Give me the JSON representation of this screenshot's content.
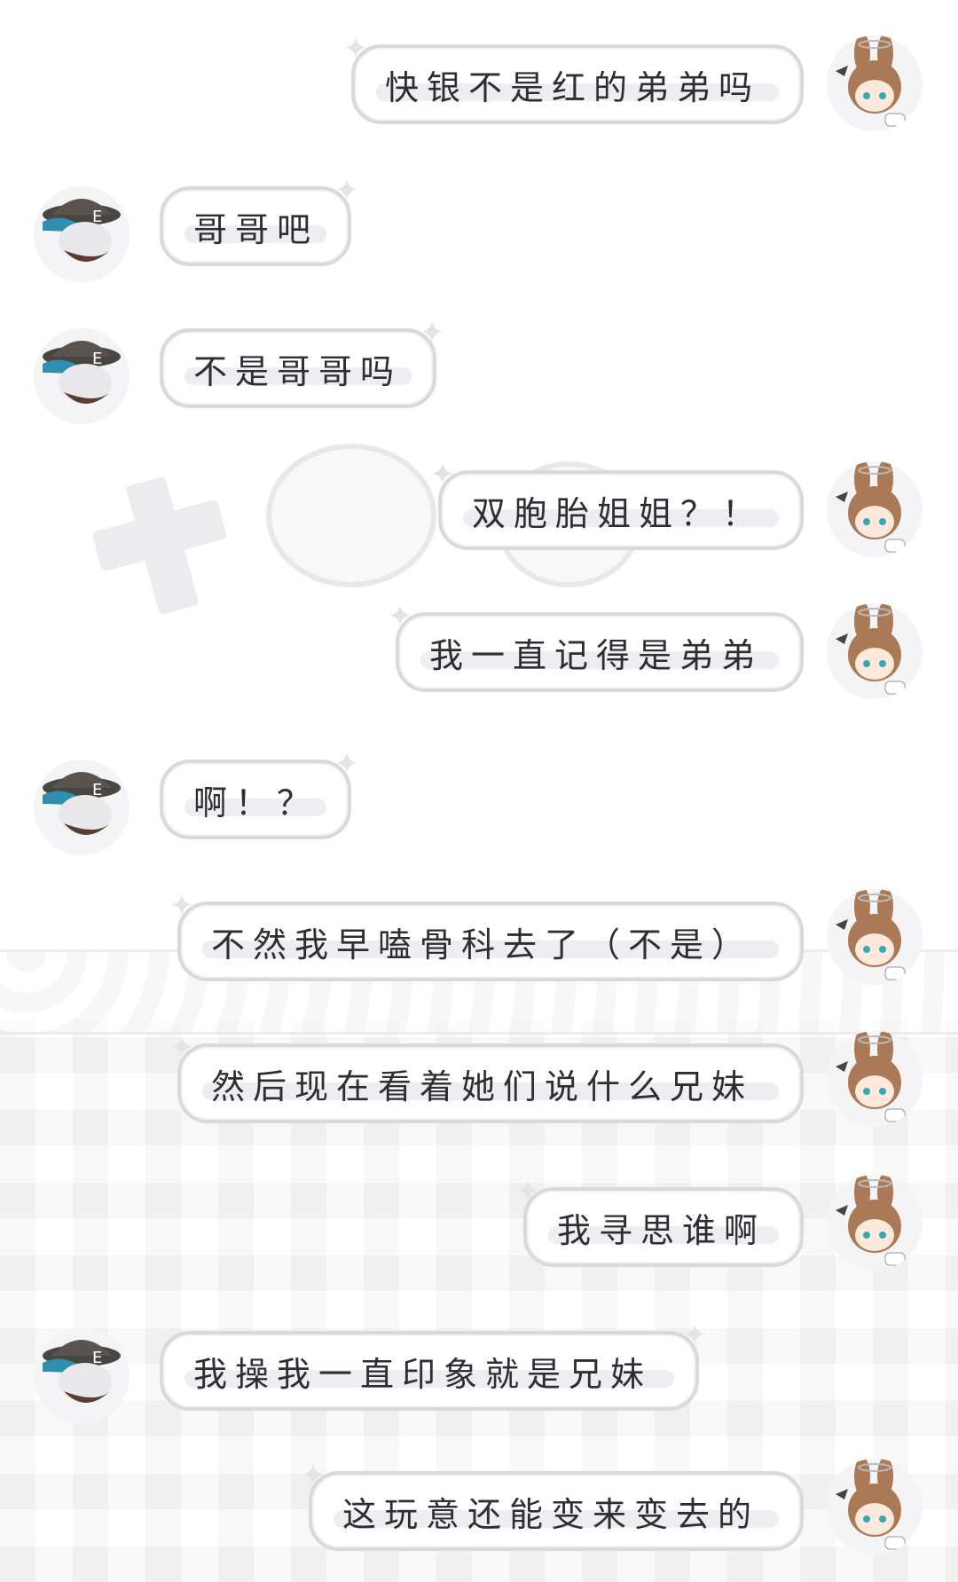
{
  "conversation": {
    "messages": [
      {
        "side": "right",
        "text": "快银不是红的弟弟吗",
        "avatar": "bunny-girl-avatar-icon"
      },
      {
        "side": "left",
        "text": "哥哥吧",
        "avatar": "hat-boy-avatar-icon"
      },
      {
        "side": "left",
        "text": "不是哥哥吗",
        "avatar": "hat-boy-avatar-icon"
      },
      {
        "side": "right",
        "text": "双胞胎姐姐？！",
        "avatar": "bunny-girl-avatar-icon"
      },
      {
        "side": "right",
        "text": "我一直记得是弟弟",
        "avatar": "bunny-girl-avatar-icon"
      },
      {
        "side": "left",
        "text": "啊！？",
        "avatar": "hat-boy-avatar-icon"
      },
      {
        "side": "right",
        "text": "不然我早嗑骨科去了（不是）",
        "avatar": "bunny-girl-avatar-icon"
      },
      {
        "side": "right",
        "text": "然后现在看着她们说什么兄妹",
        "avatar": "bunny-girl-avatar-icon"
      },
      {
        "side": "right",
        "text": "我寻思谁啊",
        "avatar": "bunny-girl-avatar-icon"
      },
      {
        "side": "left",
        "text": "我操我一直印象就是兄妹",
        "avatar": "hat-boy-avatar-icon"
      },
      {
        "side": "right",
        "text": "这玩意还能变来变去的",
        "avatar": "bunny-girl-avatar-icon"
      }
    ]
  },
  "colors": {
    "bubble_border": "#d9d9dc",
    "text": "#2e2e32",
    "highlight": "#eeedf1"
  }
}
